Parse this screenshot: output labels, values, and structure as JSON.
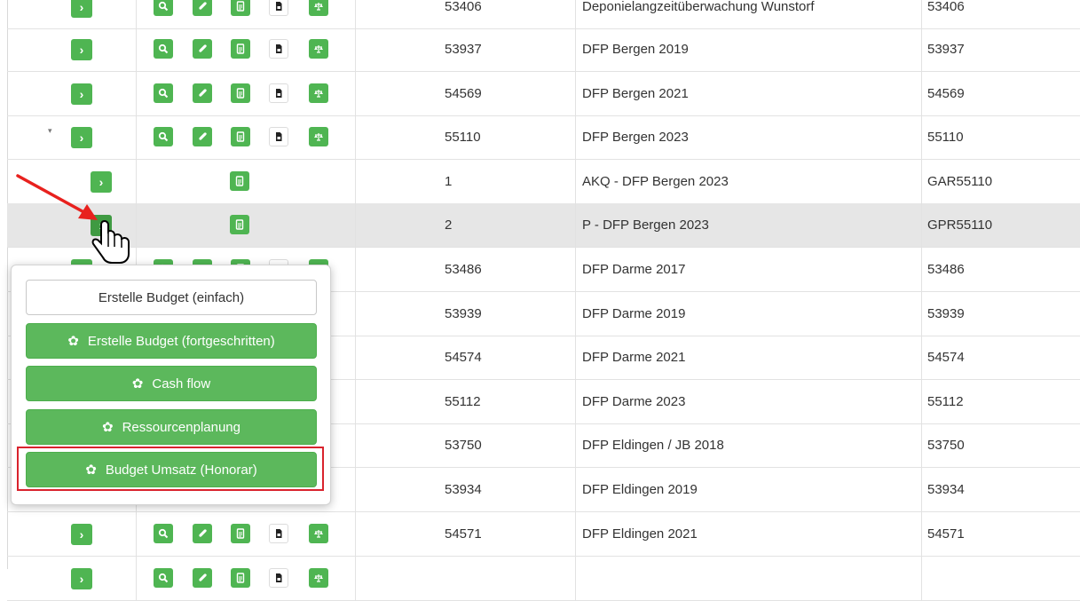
{
  "table": {
    "top_row": {
      "number": "53406",
      "name": "Deponielangzeitüberwachung Wunstorf",
      "code": "53406"
    },
    "rows": [
      {
        "number": "53937",
        "name": "DFP Bergen 2019",
        "code": "53937"
      },
      {
        "number": "54569",
        "name": "DFP Bergen 2021",
        "code": "54569"
      },
      {
        "number": "55110",
        "name": "DFP Bergen 2023",
        "code": "55110"
      },
      {
        "number": "1",
        "name": "AKQ - DFP Bergen 2023",
        "code": "GAR55110"
      },
      {
        "number": "2",
        "name": "P - DFP Bergen 2023",
        "code": "GPR55110"
      },
      {
        "number": "53486",
        "name": "DFP Darme 2017",
        "code": "53486"
      },
      {
        "number": "53939",
        "name": "DFP Darme 2019",
        "code": "53939"
      },
      {
        "number": "54574",
        "name": "DFP Darme 2021",
        "code": "54574"
      },
      {
        "number": "55112",
        "name": "DFP Darme 2023",
        "code": "55112"
      },
      {
        "number": "53750",
        "name": "DFP Eldingen / JB 2018",
        "code": "53750"
      },
      {
        "number": "53934",
        "name": "DFP Eldingen 2019",
        "code": "53934"
      },
      {
        "number": "54571",
        "name": "DFP Eldingen 2021",
        "code": "54571"
      }
    ]
  },
  "popup_menu": {
    "items": [
      {
        "label": "Erstelle Budget (einfach)",
        "style": "plain",
        "icon": ""
      },
      {
        "label": "Erstelle Budget (fortgeschritten)",
        "style": "green",
        "icon": "gear-icon"
      },
      {
        "label": "Cash flow",
        "style": "green",
        "icon": "gear-icon"
      },
      {
        "label": "Ressourcenplanung",
        "style": "green",
        "icon": "gear-icon"
      },
      {
        "label": "Budget Umsatz (Honorar)",
        "style": "green",
        "icon": "gear-icon",
        "highlighted": true
      }
    ]
  },
  "icons": {
    "expand": "chevron-right-icon",
    "search": "search-icon",
    "attach": "paperclip-icon",
    "document": "document-icon",
    "pdf": "file-lock-icon",
    "scale": "balance-icon",
    "cursor": "hand-pointer-icon",
    "annotation": "red-arrow-icon"
  },
  "colors": {
    "button_green": "#5cb85c",
    "highlight_red": "#d9232d",
    "row_highlight": "#e6e6e6"
  }
}
